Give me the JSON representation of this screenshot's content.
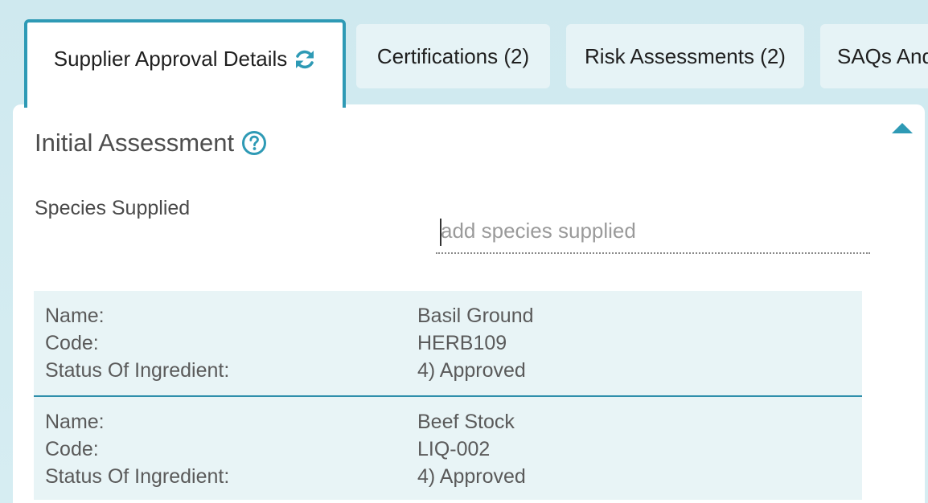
{
  "tabs": [
    {
      "label": "Supplier Approval Details",
      "icon": "refresh-icon",
      "active": true
    },
    {
      "label": "Certifications (2)"
    },
    {
      "label": "Risk Assessments (2)"
    },
    {
      "label": "SAQs And"
    }
  ],
  "section": {
    "title": "Initial Assessment",
    "help_icon": "help-circle-icon"
  },
  "species_field": {
    "label": "Species Supplied",
    "placeholder": "add species supplied",
    "value": ""
  },
  "items": [
    {
      "name_label": "Name:",
      "name": "Basil Ground",
      "code_label": "Code:",
      "code": "HERB109",
      "status_label": "Status Of Ingredient:",
      "status": "4) Approved"
    },
    {
      "name_label": "Name:",
      "name": "Beef Stock",
      "code_label": "Code:",
      "code": "LIQ-002",
      "status_label": "Status Of Ingredient:",
      "status": "4) Approved"
    }
  ],
  "colors": {
    "accent": "#2e9ab5",
    "background": "#d2ebf0",
    "row_background": "#e8f4f6"
  }
}
